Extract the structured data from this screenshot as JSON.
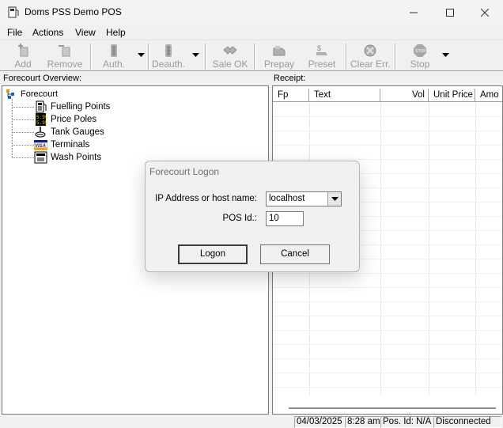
{
  "window": {
    "title": "Doms PSS Demo POS",
    "icons": [
      "app-icon",
      "minimize-icon",
      "maximize-icon",
      "close-icon"
    ]
  },
  "menu": {
    "items": [
      {
        "label": "File"
      },
      {
        "label": "Actions"
      },
      {
        "label": "View"
      },
      {
        "label": "Help"
      }
    ]
  },
  "toolbar": {
    "buttons": [
      {
        "label": "Add",
        "icon": "add-icon",
        "enabled": false
      },
      {
        "label": "Remove",
        "icon": "remove-icon",
        "enabled": false
      },
      {
        "label": "Auth.",
        "icon": "traffic-light-icon",
        "enabled": false
      },
      {
        "label": "Deauth.",
        "icon": "traffic-light-icon",
        "enabled": false
      },
      {
        "label": "Sale OK",
        "icon": "handshake-icon",
        "enabled": false
      },
      {
        "label": "Prepay",
        "icon": "prepay-icon",
        "enabled": false
      },
      {
        "label": "Preset",
        "icon": "preset-icon",
        "enabled": false
      },
      {
        "label": "Clear Err.",
        "icon": "clear-error-icon",
        "enabled": false
      },
      {
        "label": "Stop",
        "icon": "stop-icon",
        "enabled": false
      }
    ]
  },
  "forecourt": {
    "header": "Forecourt Overview:",
    "root": "Forecourt",
    "items": [
      {
        "label": "Fuelling Points",
        "icon": "fuel-pump-icon"
      },
      {
        "label": "Price Poles",
        "icon": "price-pole-icon"
      },
      {
        "label": "Tank Gauges",
        "icon": "tank-gauge-icon"
      },
      {
        "label": "Terminals",
        "icon": "card-terminal-icon"
      },
      {
        "label": "Wash Points",
        "icon": "car-wash-icon"
      }
    ]
  },
  "receipt": {
    "header": "Receipt:",
    "columns": [
      "Fp",
      "Text",
      "Vol",
      "Unit Price",
      "Amo"
    ]
  },
  "status": {
    "date": "04/03/2025",
    "time": "8:28 am",
    "pos": "Pos. Id: N/A",
    "connection": "Disconnected"
  },
  "dialog": {
    "title": "Forecourt Logon",
    "host_label": "IP Address or host name:",
    "host_value": "localhost",
    "pos_label": "POS Id.:",
    "pos_value": "10",
    "logon_label": "Logon",
    "cancel_label": "Cancel"
  },
  "colors": {
    "disabled_text": "#9a9a9a",
    "dialog_bg": "#f0f0f0",
    "window_bg": "#f0f0f0"
  }
}
